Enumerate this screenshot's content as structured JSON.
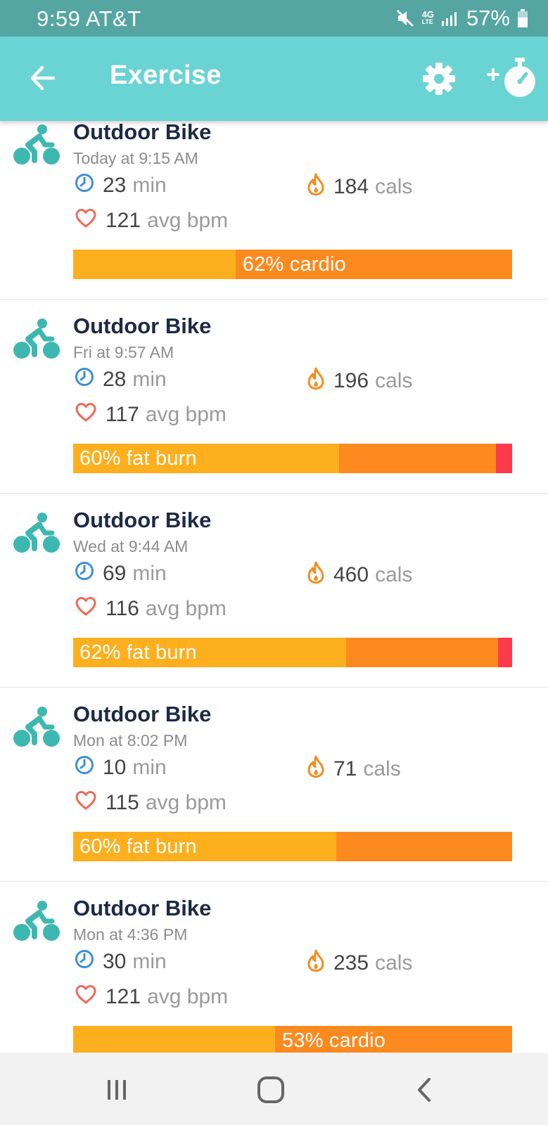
{
  "status_bar": {
    "time_carrier": "9:59 AT&T",
    "network_label": "4G",
    "network_sub": "LTE",
    "battery": "57%",
    "icons": [
      "mute-icon",
      "signal-icon",
      "battery-icon"
    ]
  },
  "app_bar": {
    "title": "Exercise",
    "icons": [
      "back-arrow-icon",
      "gear-icon",
      "add-timer-icon"
    ],
    "color": "#6ad3d3"
  },
  "colors": {
    "fat_burn": "#fdaf1e",
    "cardio": "#fd8a1f",
    "peak": "#fb3b4c",
    "bike_icon": "#3db8b0",
    "clock_icon": "#3d8fd8",
    "heart_icon": "#f06a58",
    "flame_icon": "#f78a1d"
  },
  "exercises": [
    {
      "name": "Outdoor Bike",
      "time": "Today at 9:15 AM",
      "duration": "23",
      "duration_unit": "min",
      "calories": "184",
      "calories_unit": "cals",
      "heart_rate": "121",
      "heart_rate_unit": "avg bpm",
      "zone_label": "62% cardio",
      "zones": {
        "fat_burn": 37,
        "cardio": 63,
        "peak": 0
      }
    },
    {
      "name": "Outdoor Bike",
      "time": "Fri at 9:57 AM",
      "duration": "28",
      "duration_unit": "min",
      "calories": "196",
      "calories_unit": "cals",
      "heart_rate": "117",
      "heart_rate_unit": "avg bpm",
      "zone_label": "60% fat burn",
      "zones": {
        "fat_burn": 60.5,
        "cardio": 35.8,
        "peak": 3.7
      }
    },
    {
      "name": "Outdoor Bike",
      "time": "Wed at 9:44 AM",
      "duration": "69",
      "duration_unit": "min",
      "calories": "460",
      "calories_unit": "cals",
      "heart_rate": "116",
      "heart_rate_unit": "avg bpm",
      "zone_label": "62% fat burn",
      "zones": {
        "fat_burn": 62.2,
        "cardio": 34.6,
        "peak": 3.2
      }
    },
    {
      "name": "Outdoor Bike",
      "time": "Mon at 8:02 PM",
      "duration": "10",
      "duration_unit": "min",
      "calories": "71",
      "calories_unit": "cals",
      "heart_rate": "115",
      "heart_rate_unit": "avg bpm",
      "zone_label": "60% fat burn",
      "zones": {
        "fat_burn": 60,
        "cardio": 40,
        "peak": 0
      }
    },
    {
      "name": "Outdoor Bike",
      "time": "Mon at 4:36 PM",
      "duration": "30",
      "duration_unit": "min",
      "calories": "235",
      "calories_unit": "cals",
      "heart_rate": "121",
      "heart_rate_unit": "avg bpm",
      "zone_label": "53% cardio",
      "zones": {
        "fat_burn": 46,
        "cardio": 54,
        "peak": 0
      }
    }
  ],
  "nav_bar": {
    "buttons": [
      "recents-button",
      "home-button",
      "back-button"
    ]
  }
}
